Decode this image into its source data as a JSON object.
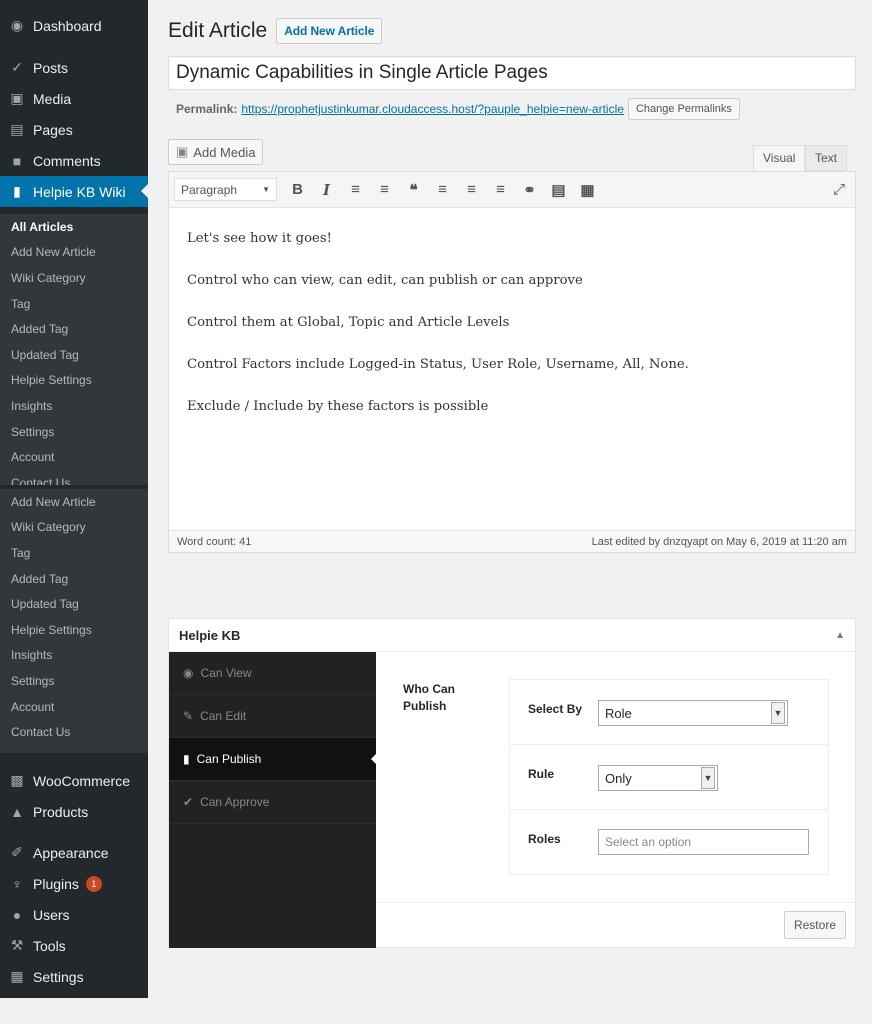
{
  "sidebar": {
    "top_items": [
      {
        "label": "Dashboard",
        "icon": "dashboard-icon"
      },
      {
        "label": "Posts",
        "icon": "pin-icon"
      },
      {
        "label": "Media",
        "icon": "media-icon"
      },
      {
        "label": "Pages",
        "icon": "pages-icon"
      },
      {
        "label": "Comments",
        "icon": "comments-icon"
      },
      {
        "label": "Helpie KB Wiki",
        "icon": "book-icon"
      }
    ],
    "submenu1": [
      "All Articles",
      "Add New Article",
      "Wiki Category",
      "Tag",
      "Added Tag",
      "Updated Tag",
      "Helpie Settings",
      "Insights",
      "Settings",
      "Account",
      "Contact Us"
    ],
    "submenu2": [
      "Add New Article",
      "Wiki Category",
      "Tag",
      "Added Tag",
      "Updated Tag",
      "Helpie Settings",
      "Insights",
      "Settings",
      "Account",
      "Contact Us"
    ],
    "bottom_items": [
      {
        "label": "WooCommerce",
        "icon": "woocommerce-icon"
      },
      {
        "label": "Products",
        "icon": "products-icon"
      },
      {
        "label": "Appearance",
        "icon": "appearance-icon"
      },
      {
        "label": "Plugins",
        "icon": "plugins-icon",
        "badge": "1"
      },
      {
        "label": "Users",
        "icon": "users-icon"
      },
      {
        "label": "Tools",
        "icon": "tools-icon"
      },
      {
        "label": "Settings",
        "icon": "settings-icon"
      }
    ]
  },
  "header": {
    "title": "Edit Article",
    "add_new": "Add New Article"
  },
  "post_title": "Dynamic Capabilities in Single Article Pages",
  "permalink": {
    "label": "Permalink:",
    "url": "https://prophetjustinkumar.cloudaccess.host/?pauple_helpie=new-article",
    "button": "Change Permalinks"
  },
  "add_media": "Add Media",
  "tabs": {
    "visual": "Visual",
    "text": "Text"
  },
  "format_select": "Paragraph",
  "content": [
    "Let's see how it goes!",
    "Control who can view, can edit, can publish or can approve",
    "Control them at Global, Topic and Article Levels",
    "Control Factors include Logged-in Status, User Role, Username, All, None.",
    "Exclude / Include by these factors is possible"
  ],
  "status": {
    "word_count": "Word count: 41",
    "last_edited": "Last edited by dnzqyapt on May 6, 2019 at 11:20 am"
  },
  "helpie_box": {
    "title": "Helpie KB",
    "tabs": [
      {
        "label": "Can View",
        "icon": "eye-icon"
      },
      {
        "label": "Can Edit",
        "icon": "pencil-icon"
      },
      {
        "label": "Can Publish",
        "icon": "book-icon"
      },
      {
        "label": "Can Approve",
        "icon": "check-icon"
      }
    ],
    "section_label_line1": "Who Can",
    "section_label_line2": "Publish",
    "fields": {
      "select_by": {
        "label": "Select By",
        "value": "Role"
      },
      "rule": {
        "label": "Rule",
        "value": "Only"
      },
      "roles": {
        "label": "Roles",
        "placeholder": "Select an option"
      }
    },
    "restore": "Restore"
  },
  "colors": {
    "sidebar": "#23282d",
    "submenu": "#32373c",
    "accent": "#0073aa",
    "badge": "#ca4a1f"
  }
}
